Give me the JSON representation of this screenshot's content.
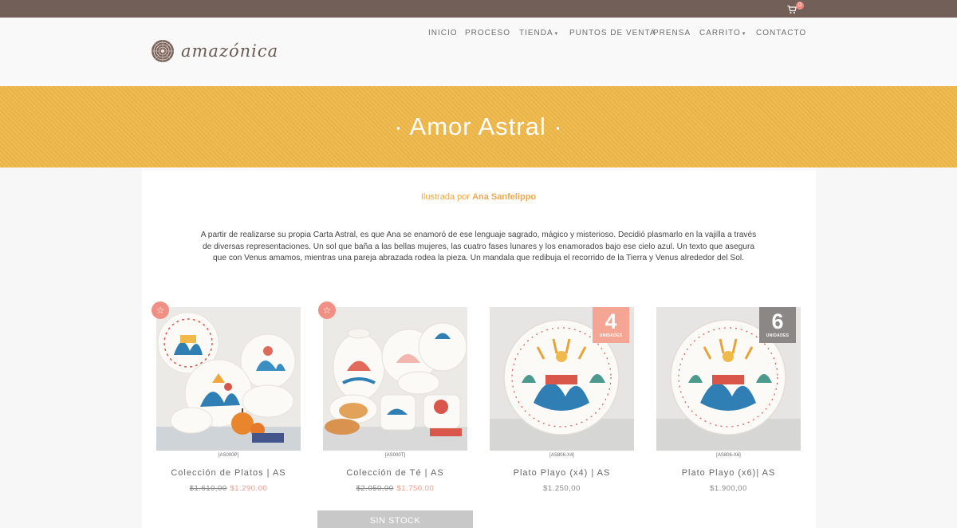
{
  "topbar": {
    "cart_count": "0"
  },
  "brand": {
    "name": "amazónica"
  },
  "nav": {
    "items": [
      {
        "label": "INICIO"
      },
      {
        "label": "PROCESO"
      },
      {
        "label": "TIENDA",
        "caret": "▾"
      },
      {
        "label": "PUNTOS DE VENTA"
      },
      {
        "label": "PRENSA"
      },
      {
        "label": "CARRITO",
        "caret": "▾"
      },
      {
        "label": "CONTACTO"
      }
    ]
  },
  "banner": {
    "title": "· Amor Astral ·"
  },
  "intro": {
    "byline_prefix": "Ilustrada por",
    "byline_author": "Ana Sanfelippo",
    "description": "A partir de realizarse su propia Carta Astral, es que Ana se enamoró de ese lenguaje sagrado, mágico y misterioso. Decidió plasmarlo en la vajilla a través de diversas representaciones. Un sol que baña a las bellas mujeres, las cuatro fases lunares y los enamorados bajo ese cielo azul. Un texto que asegura que con Venus amamos, mientras una pareja abrazada rodea la pieza. Un mandala que redibuja el recorrido de la Tierra y Venus alrededor del Sol."
  },
  "products": [
    {
      "sku": "[AS000P]",
      "name": "Colección de Platos | AS",
      "old_price": "$1.610,00",
      "price": "$1.290,00",
      "badge": "star"
    },
    {
      "sku": "[AS000T]",
      "name": "Colección de Té | AS",
      "old_price": "$2.050,00",
      "price": "$1.750,00",
      "badge": "star",
      "button": "SIN STOCK"
    },
    {
      "sku": "[AS806-X4]",
      "name": "Plato Playo (x4) | AS",
      "price": "$1.250,00",
      "qty": "4",
      "qty_unit": "UNIDADES",
      "qty_color": "#f5a593"
    },
    {
      "sku": "[AS806-X6]",
      "name": "Plato Playo (x6)| AS",
      "price": "$1.900,00",
      "qty": "6",
      "qty_unit": "UNIDADES",
      "qty_color": "#8a8784"
    }
  ],
  "colors": {
    "topbar": "#725f58",
    "banner": "#f0b94a",
    "accent": "#f0a84d",
    "sale_price": "#f29a8d"
  }
}
